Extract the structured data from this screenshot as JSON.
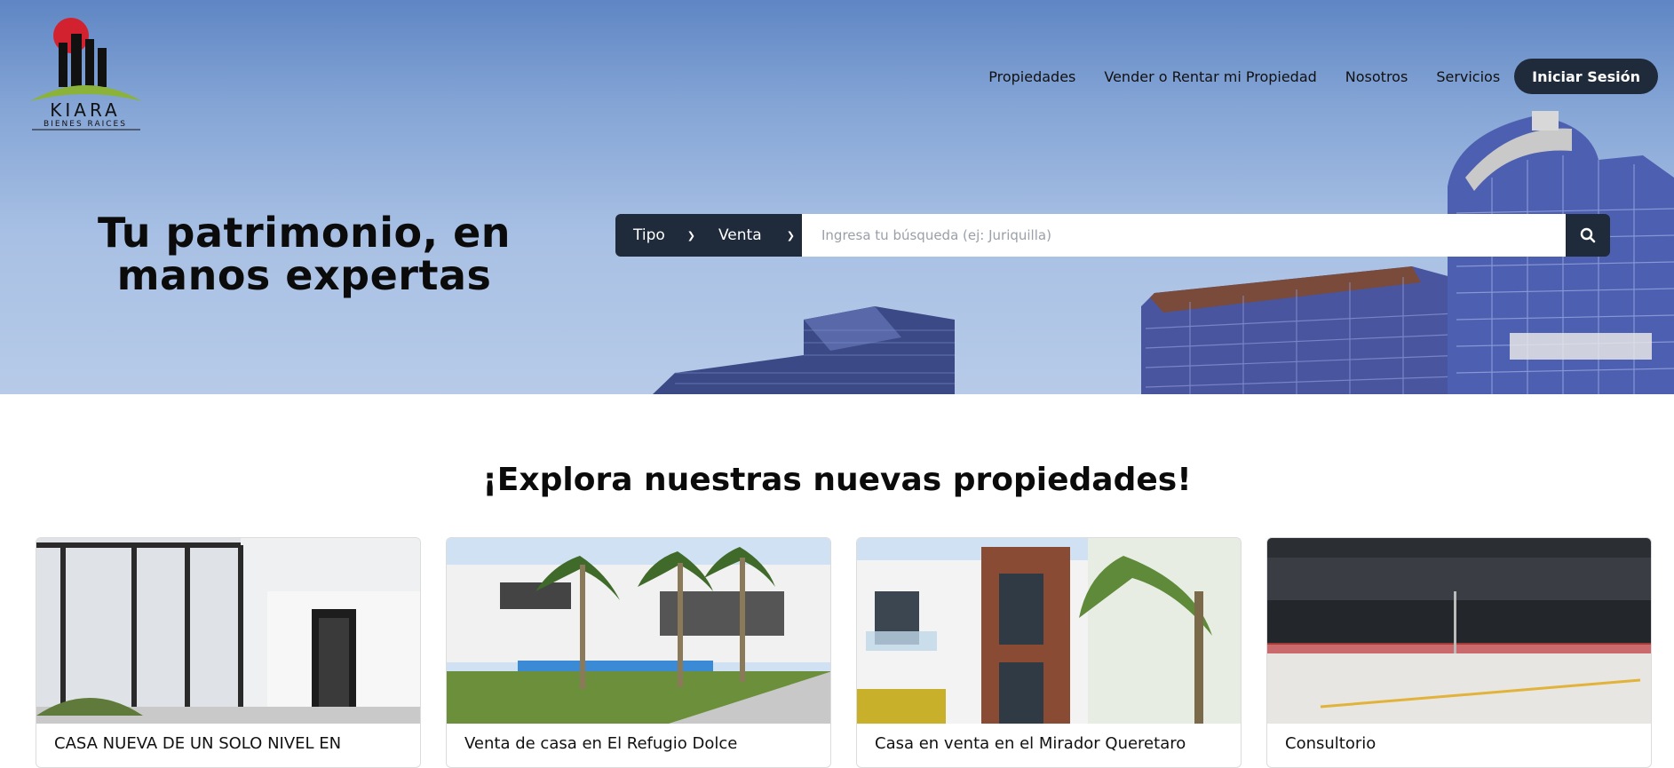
{
  "brand": {
    "name": "KIARA",
    "tagline": "BIENES RAICES"
  },
  "nav": {
    "items": [
      "Propiedades",
      "Vender o Rentar mi Propiedad",
      "Nosotros",
      "Servicios"
    ],
    "login_label": "Iniciar Sesión"
  },
  "hero": {
    "headline_line1": "Tu patrimonio, en",
    "headline_line2": "manos expertas"
  },
  "search": {
    "tipo_label": "Tipo",
    "operacion_label": "Venta",
    "placeholder": "Ingresa tu búsqueda (ej: Juriquilla)"
  },
  "section": {
    "title": "¡Explora nuestras nuevas propiedades!"
  },
  "cards": [
    {
      "title": "CASA NUEVA DE UN SOLO NIVEL EN"
    },
    {
      "title": "Venta de casa en El Refugio Dolce"
    },
    {
      "title": "Casa en venta en el Mirador Queretaro"
    },
    {
      "title": "Consultorio"
    }
  ],
  "colors": {
    "dark": "#1f2a3a",
    "sky": "#86a6d6",
    "logo_red": "#d3222f",
    "logo_green": "#8bb33a"
  }
}
